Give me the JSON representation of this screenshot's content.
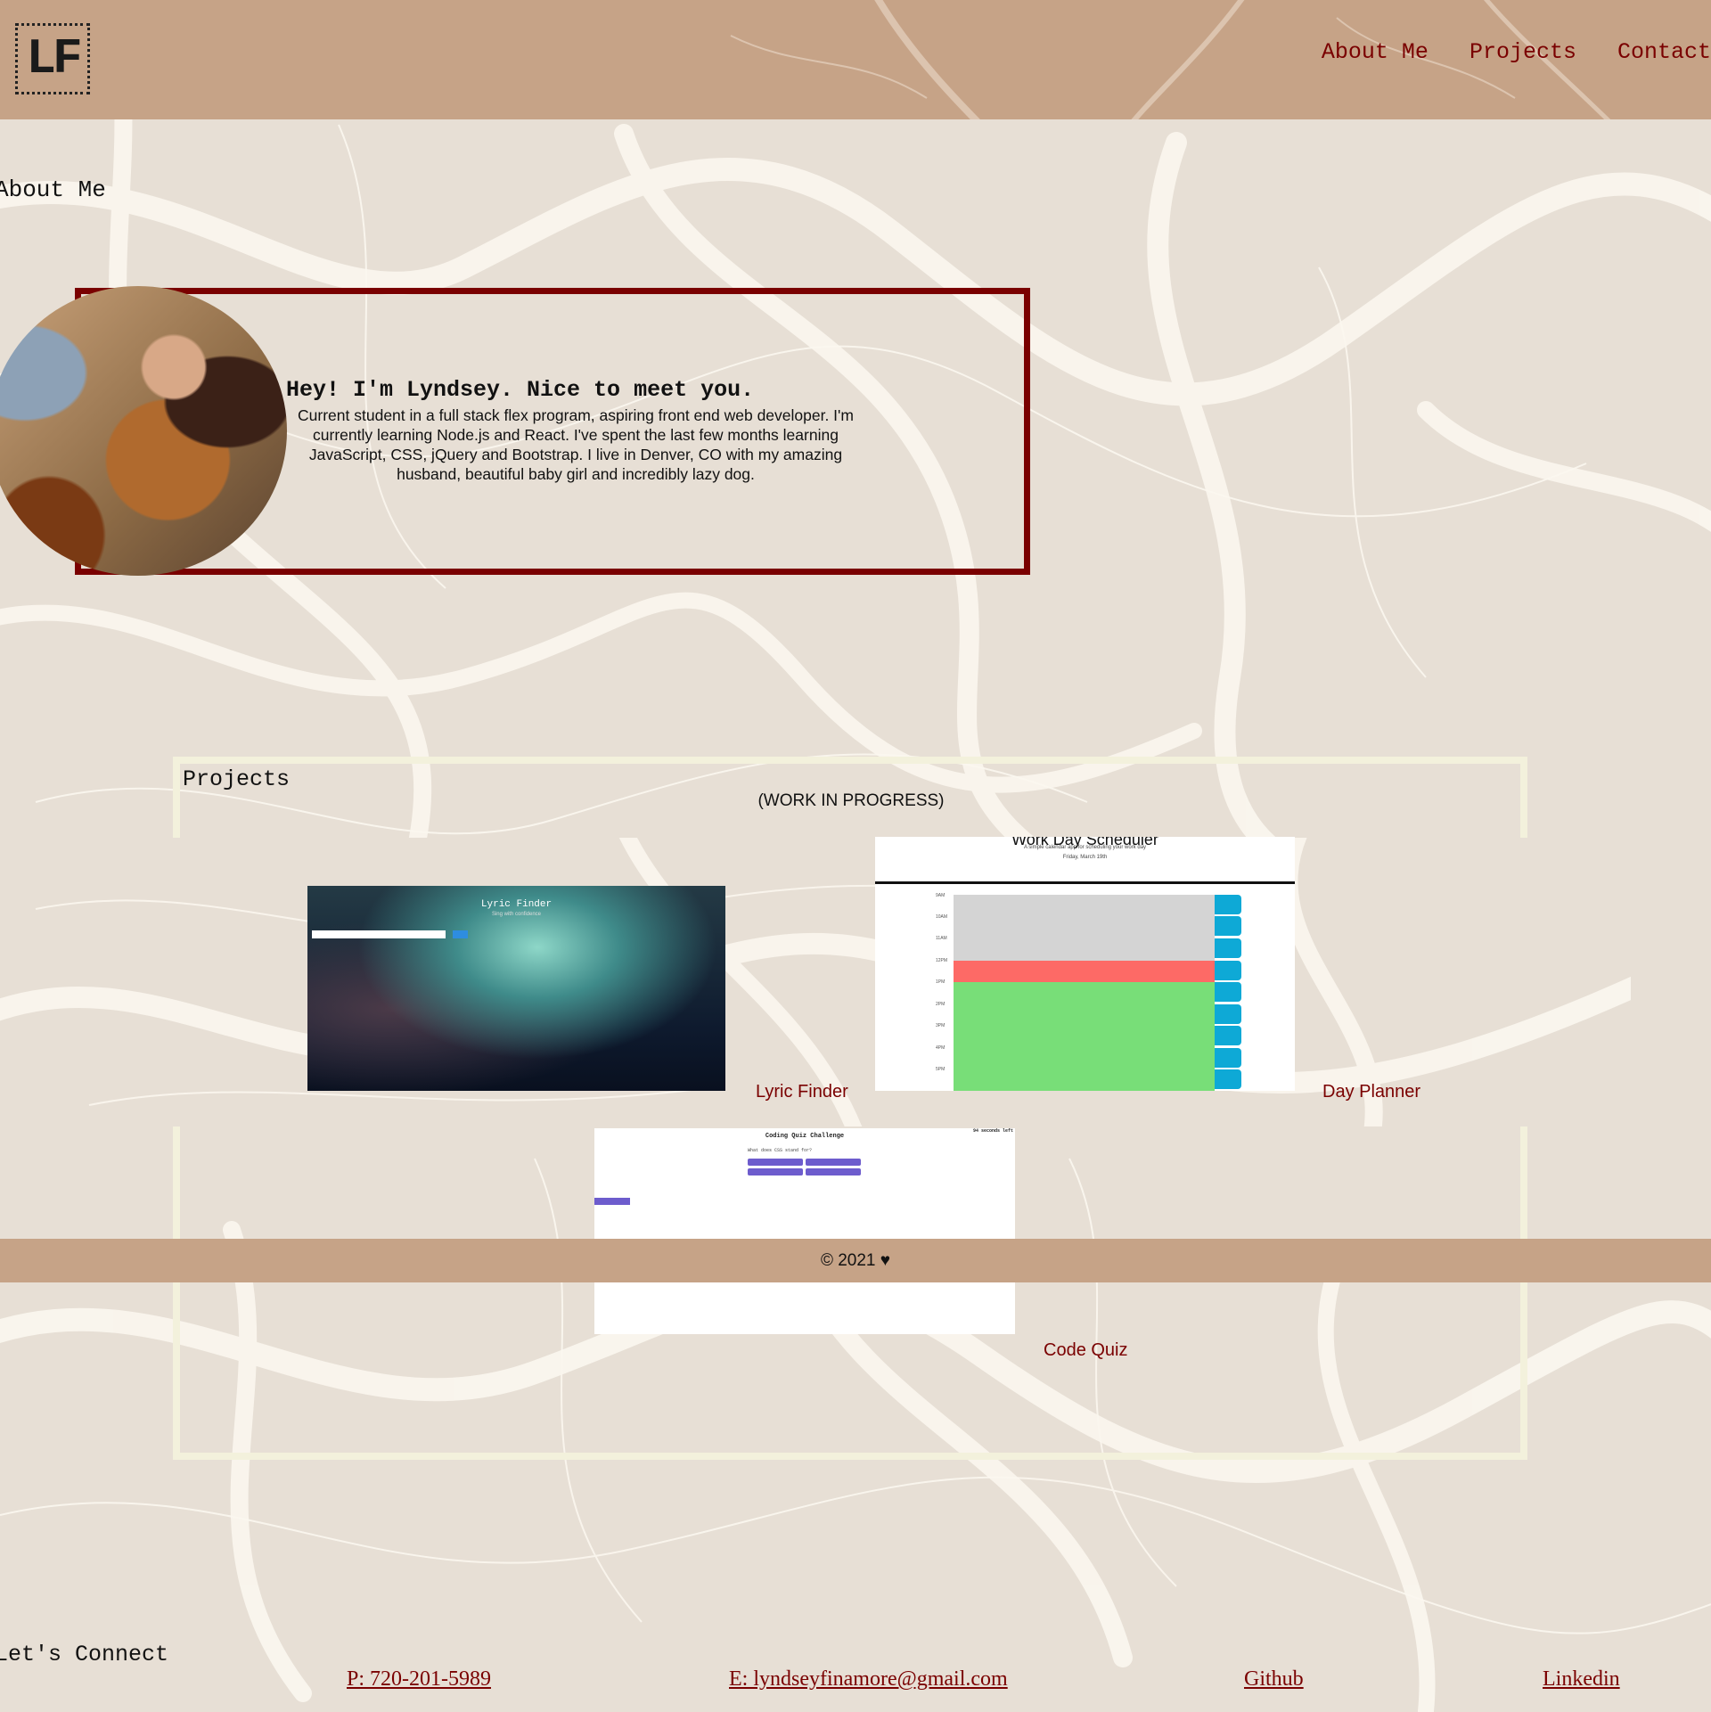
{
  "header": {
    "logo": "LF",
    "nav": [
      {
        "label": "About Me"
      },
      {
        "label": "Projects"
      },
      {
        "label": "Contact"
      }
    ]
  },
  "about": {
    "title": "About Me",
    "greeting": "Hey! I'm Lyndsey. Nice to meet you.",
    "bio": "Current student in a full stack flex program, aspiring front end web developer. I'm currently learning Node.js and React. I've spent the last few months learning JavaScript, CSS, jQuery and Bootstrap. I live in Denver, CO with my amazing husband, beautiful baby girl and incredibly lazy dog."
  },
  "projects": {
    "title": "Projects",
    "status": "(WORK IN PROGRESS)",
    "items": [
      {
        "caption": "Lyric Finder",
        "preview": {
          "title": "Lyric Finder",
          "subtitle": "Sing with confidence"
        }
      },
      {
        "caption": "Day Planner",
        "preview": {
          "title": "Work Day Scheduler",
          "subtitle": "A simple calendar app for scheduling your work day",
          "date": "Friday, March 19th",
          "hours": [
            "9AM",
            "10AM",
            "11AM",
            "12PM",
            "1PM",
            "2PM",
            "3PM",
            "4PM",
            "5PM"
          ]
        }
      },
      {
        "caption": "Code Quiz",
        "preview": {
          "title": "Coding Quiz Challenge",
          "timer": "94 seconds left",
          "question": "What does CSS stand for?"
        }
      }
    ]
  },
  "footer": {
    "text": "© 2021 ♥"
  },
  "connect": {
    "title": "Let's Connect",
    "links": [
      {
        "label": "P: 720-201-5989"
      },
      {
        "label": "E: lyndseyfinamore@gmail.com"
      },
      {
        "label": "Github"
      },
      {
        "label": "Linkedin"
      }
    ]
  },
  "colors": {
    "background": "#e7dfd5",
    "header": "#c6a387",
    "accent": "#7a0000",
    "frame": "#f3f1dc"
  }
}
